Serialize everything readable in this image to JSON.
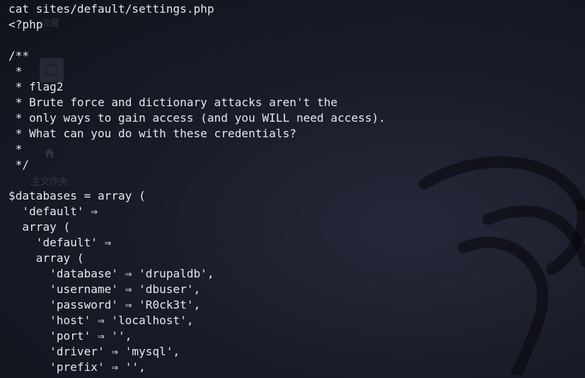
{
  "terminal": {
    "background": "#1a1c29",
    "foreground": "#e8e8ee",
    "lines": [
      "cat sites/default/settings.php",
      "<?php",
      "",
      "/**",
      " *",
      " * flag2",
      " * Brute force and dictionary attacks aren't the",
      " * only ways to gain access (and you WILL need access).",
      " * What can you do with these credentials?",
      " *",
      " */",
      "",
      "$databases = array (",
      "  'default' ⇒",
      "  array (",
      "    'default' ⇒",
      "    array (",
      "      'database' ⇒ 'drupaldb',",
      "      'username' ⇒ 'dbuser',",
      "      'password' ⇒ 'R0ck3t',",
      "      'host' ⇒ 'localhost',",
      "      'port' ⇒ '',",
      "      'driver' ⇒ 'mysql',",
      "      'prefix' ⇒ '',",
      "    ),"
    ]
  },
  "desktop_background": {
    "top_icon_label": "收藏",
    "mid_label": "主文件夹",
    "icons": [
      "circle-icon",
      "home-icon",
      "dragon-logo"
    ]
  }
}
